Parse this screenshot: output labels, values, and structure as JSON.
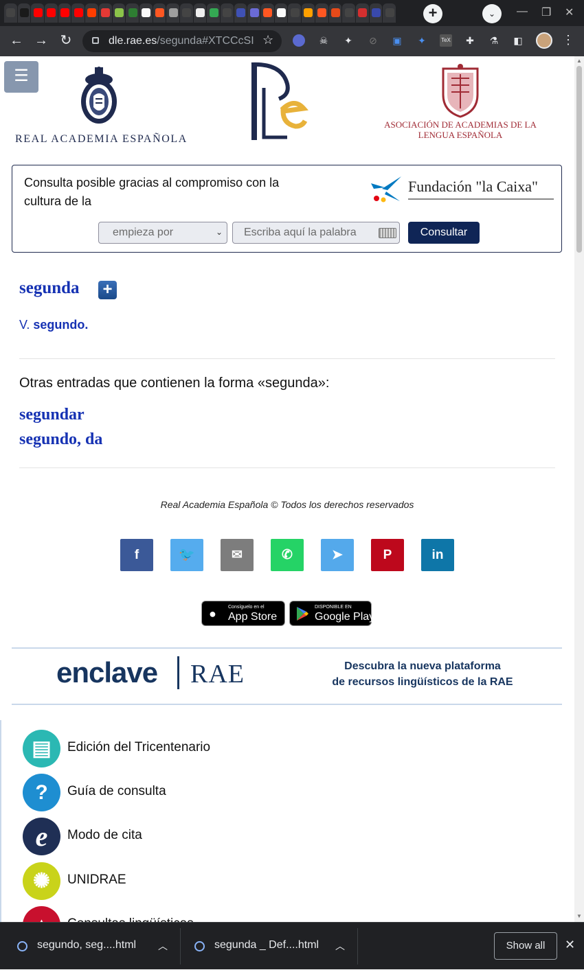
{
  "browser": {
    "url_host": "dle.rae.es",
    "url_path": "/segunda#XTCCcSI",
    "new_tab_label": "+",
    "tab_search_glyph": "⌄"
  },
  "header": {
    "menu_glyph": "☰",
    "rae_name": "REAL ACADEMIA ESPAÑOLA",
    "asale_name": "ASOCIACIÓN DE ACADEMIAS DE LA LENGUA ESPAÑOLA",
    "brand_colors": {
      "navy": "#1f2a4e",
      "gold": "#e8b23a",
      "crimson": "#a02b35"
    }
  },
  "search": {
    "sponsor_text": "Consulta posible gracias al compromiso con la cultura de la",
    "sponsor_name": "Fundación \"la Caixa\"",
    "mode_selected": "empieza por",
    "input_placeholder": "Escriba aquí la palabra",
    "submit_label": "Consultar"
  },
  "entry": {
    "title": "segunda",
    "see_prefix": "V.",
    "see_target": "segundo."
  },
  "others": {
    "heading": "Otras entradas que contienen la forma «segunda»:",
    "items": [
      "segundar",
      "segundo, da"
    ]
  },
  "footer": {
    "copyright": "Real Academia Española © Todos los derechos reservados",
    "share": [
      {
        "icon": "facebook-icon",
        "glyph": "f",
        "color": "#3b5998"
      },
      {
        "icon": "twitter-icon",
        "glyph": "🐦",
        "color": "#55acee"
      },
      {
        "icon": "email-icon",
        "glyph": "✉",
        "color": "#7d7d7d"
      },
      {
        "icon": "whatsapp-icon",
        "glyph": "✆",
        "color": "#25d366"
      },
      {
        "icon": "telegram-icon",
        "glyph": "➤",
        "color": "#54a9eb"
      },
      {
        "icon": "pinterest-icon",
        "glyph": "P",
        "color": "#bd081c"
      },
      {
        "icon": "linkedin-icon",
        "glyph": "in",
        "color": "#0e76a8"
      }
    ],
    "appstore_small": "Consíguelo en el",
    "appstore_big": "App Store",
    "googleplay_small": "DISPONIBLE EN",
    "googleplay_big": "Google Play",
    "enclave_word": "enclave",
    "enclave_rae": "RAE",
    "enclave_desc_1": "Descubra la nueva plataforma",
    "enclave_desc_2": "de recursos lingüísticos de la RAE",
    "links": [
      {
        "label": "Edición del Tricentenario",
        "icon": "book-icon",
        "color": "#2bb8b3"
      },
      {
        "label": "Guía de consulta",
        "icon": "question-icon",
        "color": "#1e8ed1"
      },
      {
        "label": "Modo de cita",
        "icon": "e-letter-icon",
        "color": "#1f2f55"
      },
      {
        "label": "UNIDRAE",
        "icon": "lightbulb-icon",
        "color": "#c9d31a"
      },
      {
        "label": "Consultas lingüísticas",
        "icon": "cap-icon",
        "color": "#c8102e"
      }
    ]
  },
  "downloads": {
    "items": [
      "segundo, seg....html",
      "segunda _ Def....html"
    ],
    "show_all": "Show all"
  }
}
